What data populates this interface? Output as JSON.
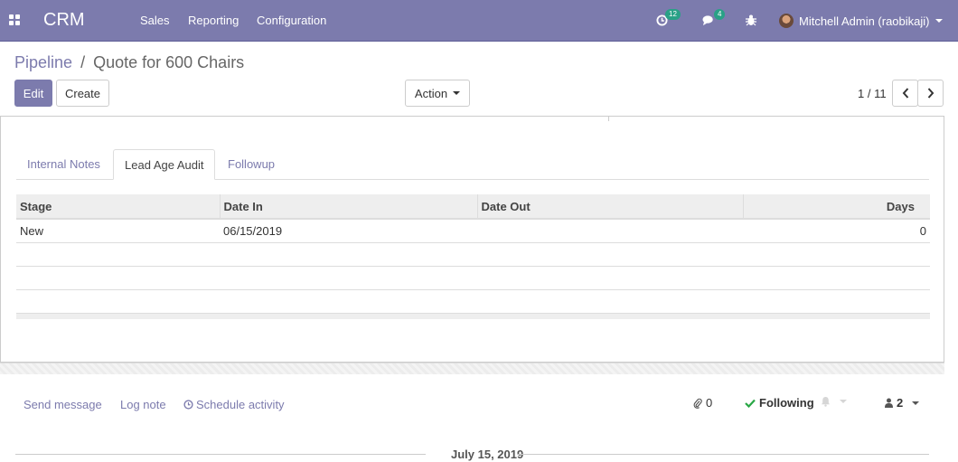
{
  "navbar": {
    "brand": "CRM",
    "menu": [
      "Sales",
      "Reporting",
      "Configuration"
    ],
    "activities_count": "12",
    "messages_count": "4",
    "user_name": "Mitchell Admin (raobikaji)"
  },
  "breadcrumb": {
    "parent": "Pipeline",
    "separator": "/",
    "current": "Quote for 600 Chairs"
  },
  "buttons": {
    "edit": "Edit",
    "create": "Create",
    "action": "Action"
  },
  "pager": {
    "value": "1 / 11"
  },
  "tabs": [
    "Internal Notes",
    "Lead Age Audit",
    "Followup"
  ],
  "table": {
    "headers": [
      "Stage",
      "Date In",
      "Date Out",
      "Days"
    ],
    "rows": [
      {
        "stage": "New",
        "date_in": "06/15/2019",
        "date_out": "",
        "days": "0"
      }
    ]
  },
  "chatter": {
    "send_message": "Send message",
    "log_note": "Log note",
    "schedule_activity": "Schedule activity",
    "attachments_count": "0",
    "following": "Following",
    "followers_count": "2",
    "date_separator": "July 15, 2019"
  },
  "colors": {
    "brand": "#7c7bad",
    "badge": "#29a186",
    "following_check": "#28a745"
  }
}
